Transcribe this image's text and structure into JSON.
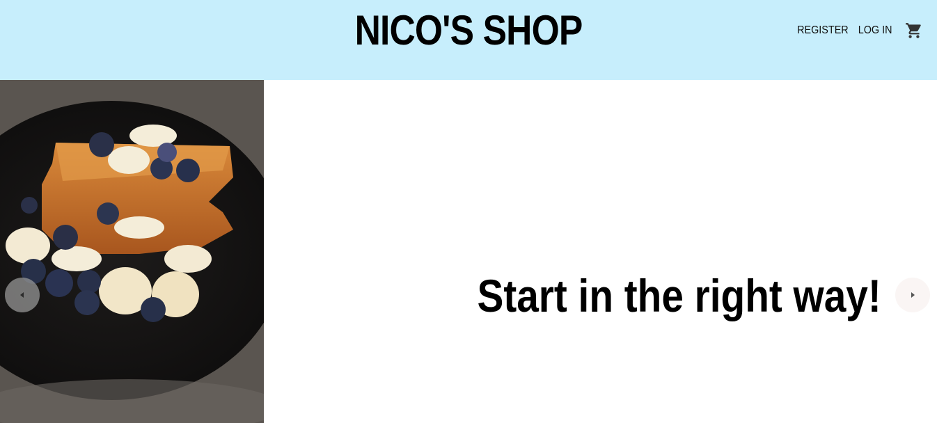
{
  "header": {
    "brand": "NICO'S SHOP",
    "nav": {
      "register": "REGISTER",
      "login": "LOG IN"
    },
    "cart_icon": "shopping-cart-icon",
    "background": "#c7eefc"
  },
  "hero": {
    "slogan": "Start in the right way!",
    "image": "french-toast-with-bananas-and-blueberries",
    "prev_icon": "chevron-left-icon",
    "next_icon": "chevron-right-icon"
  }
}
